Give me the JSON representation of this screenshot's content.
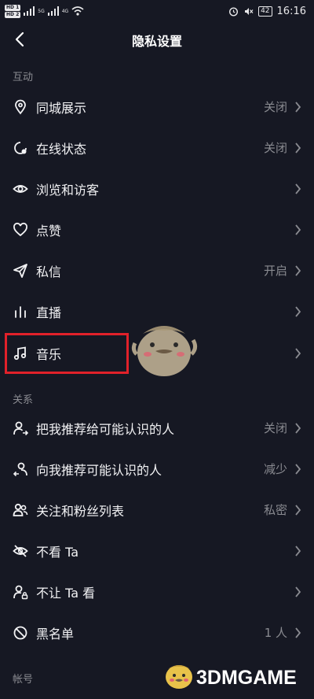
{
  "status_bar": {
    "left": {
      "hd1": "HD 1",
      "hd2": "HD 2",
      "sig1": "5G",
      "sig2": "4G"
    },
    "right": {
      "battery": "42",
      "time": "16:16"
    }
  },
  "header": {
    "title": "隐私设置",
    "back_icon": "chevron-left-icon"
  },
  "sections": [
    {
      "title": "互动",
      "items": [
        {
          "icon": "location-pin-icon",
          "label": "同城展示",
          "value": "关闭"
        },
        {
          "icon": "online-status-icon",
          "label": "在线状态",
          "value": "关闭"
        },
        {
          "icon": "eye-icon",
          "label": "浏览和访客",
          "value": ""
        },
        {
          "icon": "heart-icon",
          "label": "点赞",
          "value": ""
        },
        {
          "icon": "paper-plane-icon",
          "label": "私信",
          "value": "开启"
        },
        {
          "icon": "live-bars-icon",
          "label": "直播",
          "value": ""
        },
        {
          "icon": "music-note-icon",
          "label": "音乐",
          "value": ""
        }
      ]
    },
    {
      "title": "关系",
      "items": [
        {
          "icon": "recommend-out-icon",
          "label": "把我推荐给可能认识的人",
          "value": "关闭"
        },
        {
          "icon": "recommend-in-icon",
          "label": "向我推荐可能认识的人",
          "value": "减少"
        },
        {
          "icon": "followers-icon",
          "label": "关注和粉丝列表",
          "value": "私密"
        },
        {
          "icon": "eye-off-icon",
          "label": "不看 Ta",
          "value": ""
        },
        {
          "icon": "user-lock-icon",
          "label": "不让 Ta 看",
          "value": ""
        },
        {
          "icon": "block-icon",
          "label": "黑名单",
          "value": "1 人"
        }
      ]
    },
    {
      "title": "帐号",
      "items": []
    }
  ],
  "watermark": {
    "text": "3DMGAME"
  },
  "colors": {
    "background": "#161823",
    "highlight_border": "#e1212a",
    "secondary_text": "#8a8b91"
  }
}
